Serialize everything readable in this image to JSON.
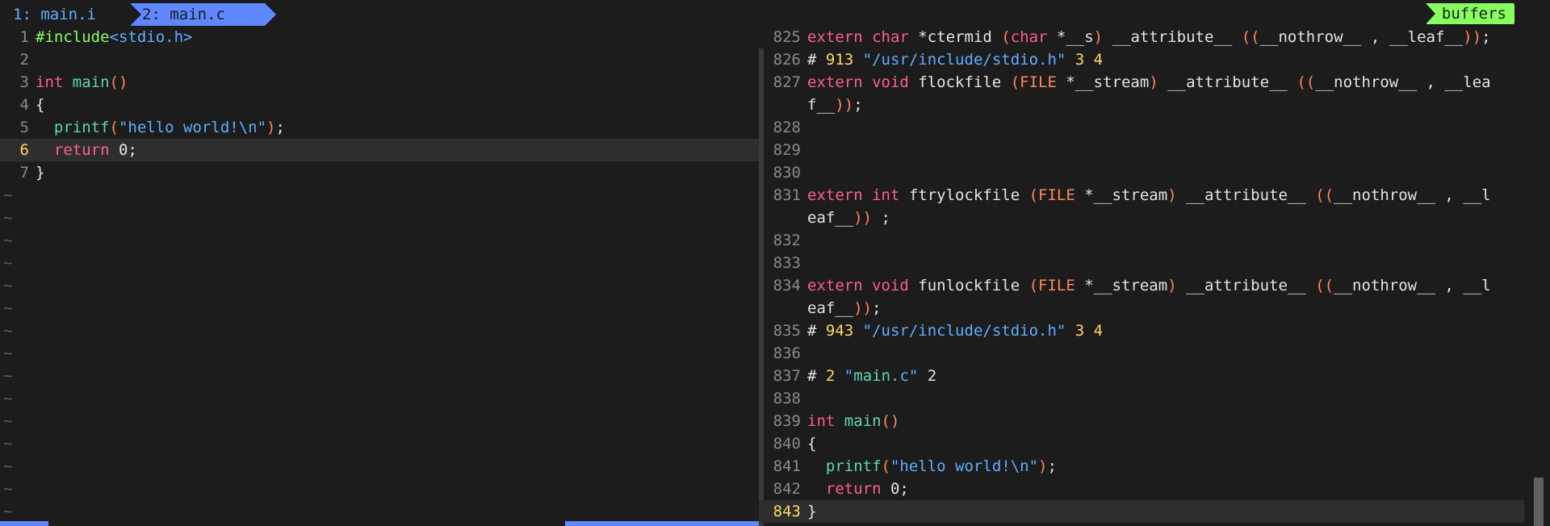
{
  "tabs": [
    {
      "label": "1: main.i"
    },
    {
      "label": "2: main.c"
    }
  ],
  "buffers_label": "buffers",
  "left": {
    "lines": [
      {
        "n": "1",
        "text": "#include<stdio.h>"
      },
      {
        "n": "2",
        "text": ""
      },
      {
        "n": "3",
        "text": "int main()"
      },
      {
        "n": "4",
        "text": "{"
      },
      {
        "n": "5",
        "text": "  printf(\"hello world!\\n\");"
      },
      {
        "n": "6",
        "text": "  return 0;"
      },
      {
        "n": "7",
        "text": "}"
      }
    ],
    "tilde": "~"
  },
  "right": {
    "lines": [
      {
        "n": "825",
        "text": "extern char *ctermid (char *__s) __attribute__ ((__nothrow__ , __leaf__));"
      },
      {
        "n": "826",
        "text": "# 913 \"/usr/include/stdio.h\" 3 4"
      },
      {
        "n": "827",
        "text": "extern void flockfile (FILE *__stream) __attribute__ ((__nothrow__ , __lea"
      },
      {
        "n": "",
        "text": "f__));"
      },
      {
        "n": "828",
        "text": ""
      },
      {
        "n": "829",
        "text": ""
      },
      {
        "n": "830",
        "text": ""
      },
      {
        "n": "831",
        "text": "extern int ftrylockfile (FILE *__stream) __attribute__ ((__nothrow__ , __l"
      },
      {
        "n": "",
        "text": "eaf__)) ;"
      },
      {
        "n": "832",
        "text": ""
      },
      {
        "n": "833",
        "text": ""
      },
      {
        "n": "834",
        "text": "extern void funlockfile (FILE *__stream) __attribute__ ((__nothrow__ , __l"
      },
      {
        "n": "",
        "text": "eaf__));"
      },
      {
        "n": "835",
        "text": "# 943 \"/usr/include/stdio.h\" 3 4"
      },
      {
        "n": "836",
        "text": ""
      },
      {
        "n": "837",
        "text": "# 2 \"main.c\" 2"
      },
      {
        "n": "838",
        "text": ""
      },
      {
        "n": "839",
        "text": "int main()"
      },
      {
        "n": "840",
        "text": "{"
      },
      {
        "n": "841",
        "text": "  printf(\"hello world!\\n\");"
      },
      {
        "n": "842",
        "text": "  return 0;"
      },
      {
        "n": "843",
        "text": "}"
      }
    ]
  },
  "colors": {
    "background": "#1c1c1c",
    "keyword": "#ff5f87",
    "function": "#5fd7af",
    "string": "#5fafff",
    "number": "#ffd75f",
    "preproc": "#87ff5f",
    "attribute": "#ff875f",
    "tab_active": "#5f87ff",
    "buffers": "#87ff5f"
  }
}
